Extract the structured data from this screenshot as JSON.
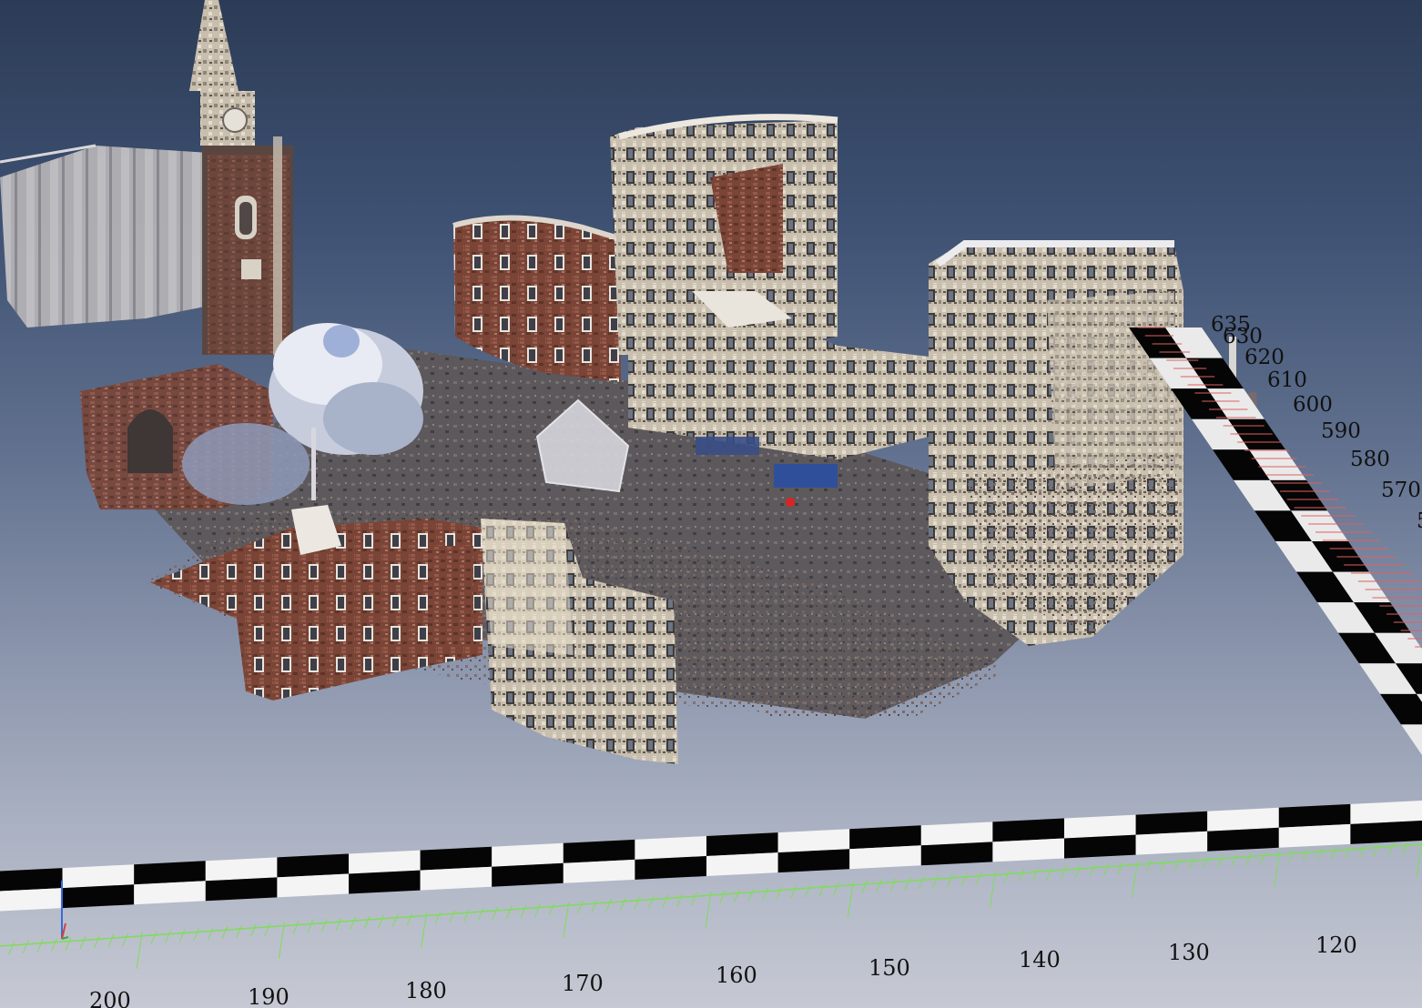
{
  "viewer": {
    "name": "point-cloud-viewer",
    "background_top": "#2c3c57",
    "background_bottom": "#c6c9d3"
  },
  "scene": {
    "church_tower": "church-tower-point-cloud",
    "buildings": [
      "left-building-facade",
      "curved-brick-building",
      "central-white-building",
      "right-corner-building",
      "foreground-brick-building",
      "foreground-white-building"
    ],
    "tree": "tree-point-cloud"
  },
  "x_axis": {
    "labels": [
      "200",
      "190",
      "180",
      "170",
      "160",
      "150",
      "140",
      "130",
      "120"
    ],
    "tick_color": "#7fdc5a"
  },
  "y_axis": {
    "labels": [
      "635",
      "630",
      "620",
      "610",
      "600",
      "590",
      "580",
      "570",
      "5"
    ],
    "tick_color": "#e06060"
  },
  "orientation_gizmo": {
    "axes": [
      "x",
      "y",
      "z"
    ]
  }
}
